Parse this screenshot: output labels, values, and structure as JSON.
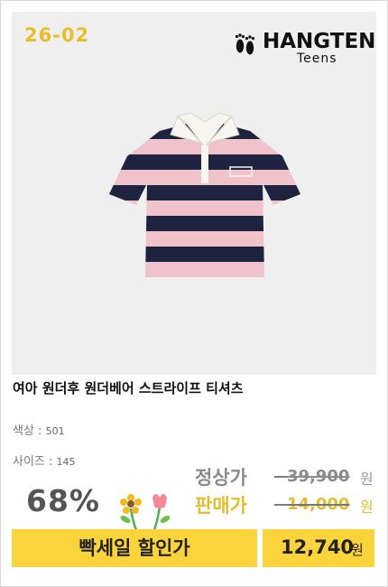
{
  "product": {
    "code": "26-02",
    "brand": {
      "name": "HANGTEN",
      "sub": "Teens",
      "logo_icon": "feet-icon"
    },
    "image": {
      "description_icon": "striped-polo-shirt",
      "colors": {
        "navy": "#1e2440",
        "pink": "#efc2cc",
        "collar": "#f7f5ef"
      }
    },
    "title": "여아 원더후 원더베어 스트라이프 티셔츠",
    "options": {
      "color_label": "색상 :",
      "color_value": "501",
      "size_label": "사이즈 :",
      "size_value": "145"
    }
  },
  "pricing": {
    "discount": "68%",
    "regular_label": "정상가",
    "regular_price": "39,900",
    "sale_label": "판매가",
    "sale_price": "14,000",
    "currency": "원",
    "flash_label": "빡세일 할인가",
    "flash_price": "12,740",
    "accent_color": "#fbd33b",
    "label_yellow": "#e3bd2f"
  }
}
